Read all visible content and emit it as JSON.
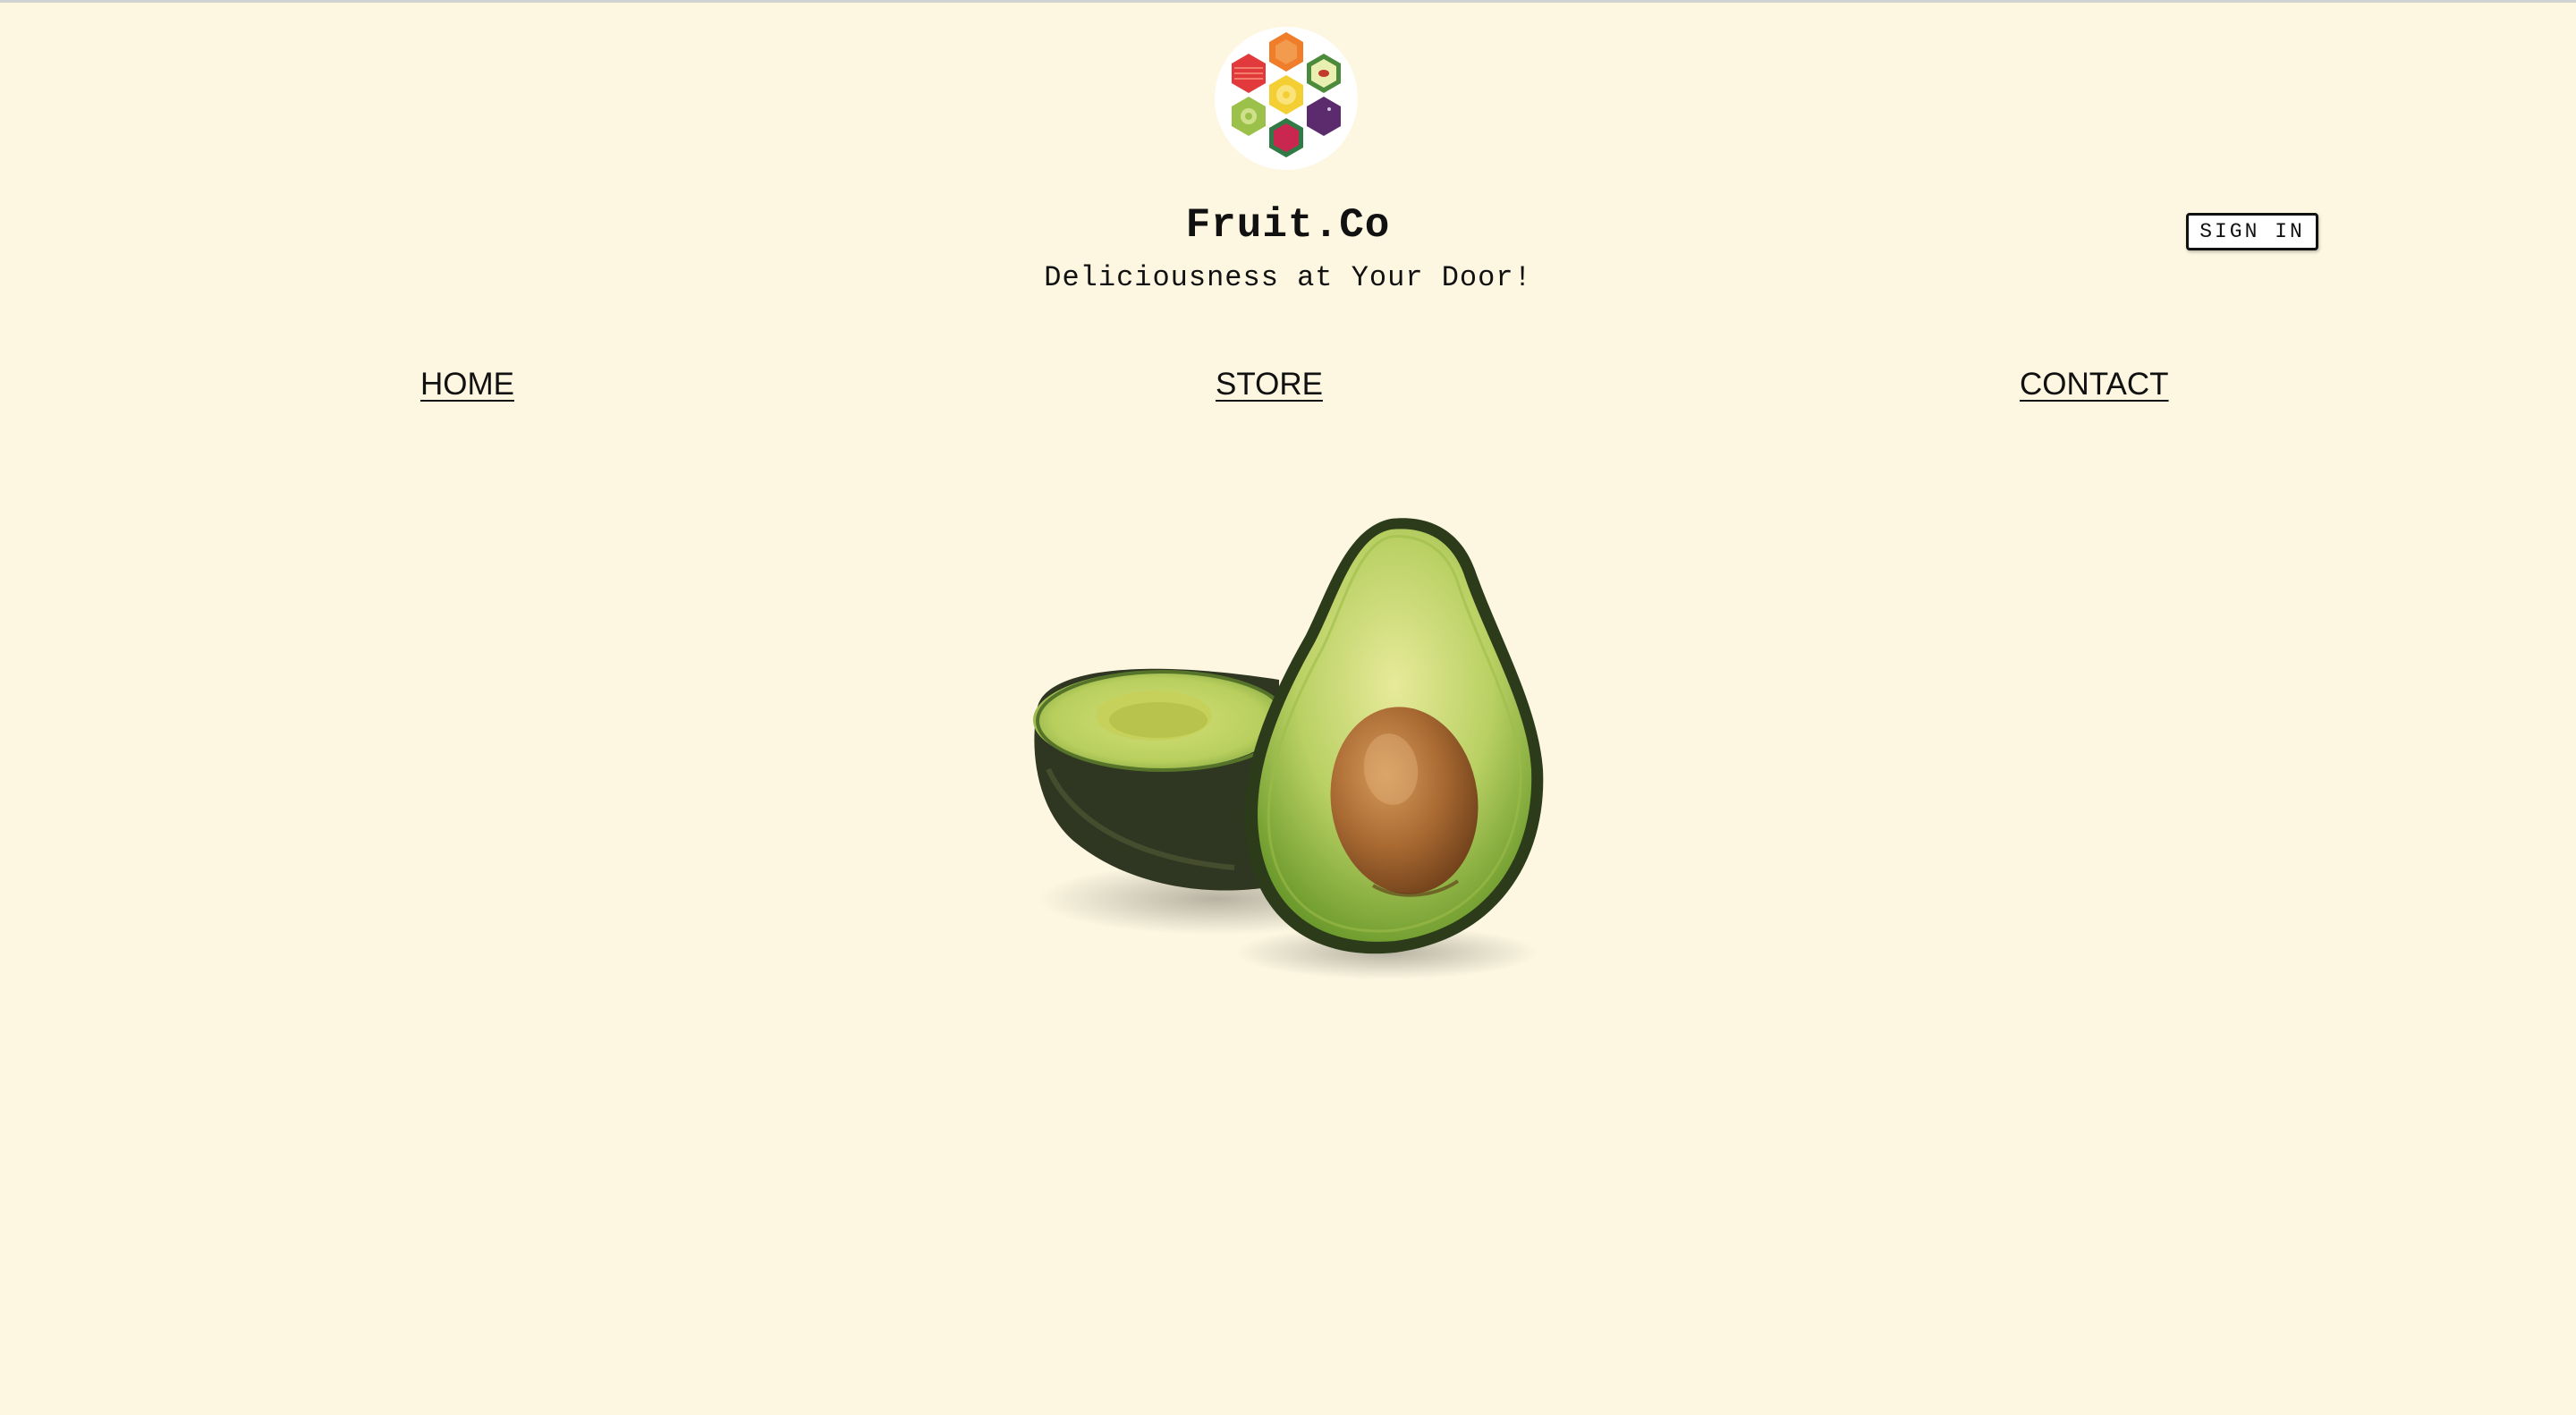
{
  "header": {
    "logo_icon": "fruit-hexagon-logo-icon",
    "brand_name": "Fruit.Co",
    "tagline": "Deliciousness at Your Door!",
    "sign_in_label": "SIGN IN"
  },
  "nav": {
    "items": [
      {
        "label": "HOME"
      },
      {
        "label": "STORE"
      },
      {
        "label": "CONTACT"
      }
    ]
  },
  "hero": {
    "image": "avocado-halves-image"
  },
  "colors": {
    "background": "#fdf7e1",
    "text": "#111111",
    "logo_red": "#e23a3c",
    "logo_orange": "#ef7d2a",
    "logo_yellow": "#f4cf33",
    "logo_lime": "#9cc14a",
    "logo_purple": "#5c2b6e",
    "logo_magenta": "#c9274f"
  }
}
